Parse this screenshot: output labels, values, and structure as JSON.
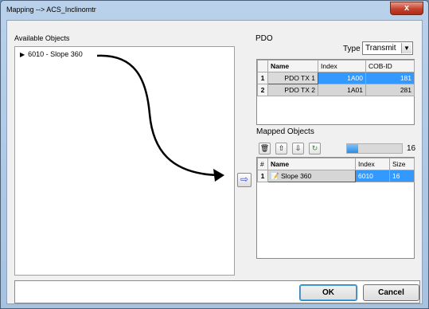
{
  "window": {
    "title": "Mapping --> ACS_Inclinomtr",
    "close_glyph": "x"
  },
  "available": {
    "label": "Available Objects",
    "items": [
      {
        "label": "6010 - Slope 360",
        "icon": "triangle-right-icon"
      }
    ]
  },
  "pdo": {
    "label": "PDO",
    "type_label": "Type",
    "type_value": "Transmit",
    "columns": [
      "",
      "Name",
      "Index",
      "COB-ID"
    ],
    "rows": [
      {
        "num": "1",
        "name": "PDO TX 1",
        "index": "1A00",
        "cob": "181"
      },
      {
        "num": "2",
        "name": "PDO TX 2",
        "index": "1A01",
        "cob": "281"
      }
    ]
  },
  "mapped": {
    "label": "Mapped Objects",
    "toolbar": {
      "delete": "trash-icon",
      "up": "arrow-up-icon",
      "down": "arrow-down-icon",
      "refresh": "refresh-icon"
    },
    "progress_fraction": 0.2,
    "count": "16",
    "columns": [
      "#",
      "Name",
      "Index",
      "Size"
    ],
    "rows": [
      {
        "num": "1",
        "name": "Slope 360",
        "index": "6010",
        "size": "16"
      }
    ]
  },
  "map_button_icon": "arrow-right-icon",
  "buttons": {
    "ok": "OK",
    "cancel": "Cancel"
  },
  "colors": {
    "selection": "#3399ff",
    "titlebar": "#b9d1ea",
    "close": "#c4412d"
  }
}
